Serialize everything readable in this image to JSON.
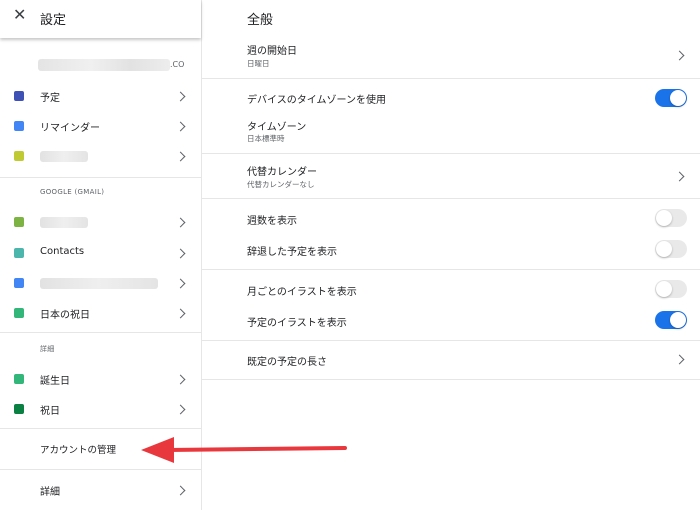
{
  "sidebar": {
    "title": "設定",
    "account": {
      "suffix": ".CO"
    },
    "my_calendars": [
      {
        "label": "予定",
        "color": "#3f51b5",
        "blurred": false
      },
      {
        "label": "リマインダー",
        "color": "#4285f4",
        "blurred": false
      },
      {
        "label": "",
        "color": "#c0ca33",
        "blurred": true
      }
    ],
    "google_section_label": "GOOGLE (GMAIL)",
    "google_calendars": [
      {
        "label": "",
        "color": "#7cb342",
        "blurred": true
      },
      {
        "label": "Contacts",
        "color": "#4db6ac",
        "blurred": false
      },
      {
        "label": "",
        "color": "#4285f4",
        "blurred": true
      },
      {
        "label": "日本の祝日",
        "color": "#33b679",
        "blurred": false
      }
    ],
    "details_section_label": "詳細",
    "other_calendars": [
      {
        "label": "誕生日",
        "color": "#33b679"
      },
      {
        "label": "祝日",
        "color": "#0b8043"
      }
    ],
    "manage_accounts": "アカウントの管理",
    "more_details": "詳細"
  },
  "main": {
    "title": "全般",
    "week_start": {
      "title": "週の開始日",
      "value": "日曜日"
    },
    "device_timezone": {
      "title": "デバイスのタイムゾーンを使用",
      "on": true
    },
    "timezone": {
      "title": "タイムゾーン",
      "value": "日本標準時"
    },
    "alt_calendar": {
      "title": "代替カレンダー",
      "value": "代替カレンダーなし"
    },
    "show_week_numbers": {
      "title": "週数を表示",
      "on": false
    },
    "show_declined": {
      "title": "辞退した予定を表示",
      "on": false
    },
    "monthly_illustrations": {
      "title": "月ごとのイラストを表示",
      "on": false
    },
    "event_illustrations": {
      "title": "予定のイラストを表示",
      "on": true
    },
    "default_duration": {
      "title": "既定の予定の長さ"
    }
  },
  "colors": {
    "accent": "#1a73e8",
    "annotation_arrow": "#e8383d"
  }
}
